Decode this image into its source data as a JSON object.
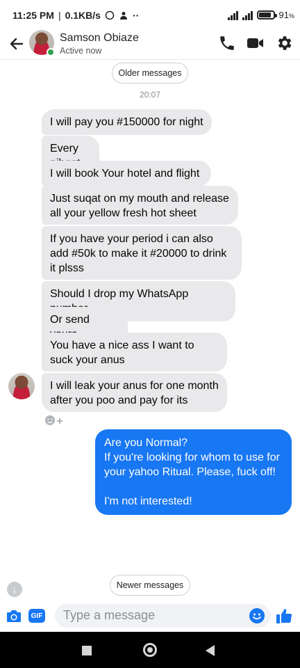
{
  "status_bar": {
    "time": "11:25 PM",
    "speed": "0.1KB/s",
    "battery": "91"
  },
  "header": {
    "name": "Samson Obiaze",
    "status": "Active now"
  },
  "chat": {
    "older_label": "Older messages",
    "timestamp": "20:07",
    "received": [
      "I will pay you #150000 for night",
      "Every nihggt",
      "I will book Your hotel and flight",
      "Just suqat on my mouth and release all your yellow fresh hot sheet",
      "If you have your period i can also add #50k to make it #20000 to drink it plsss",
      "Should I drop my WhatsApp number",
      "Or send yours",
      "You have a nice ass I want to suck your anus",
      "I will leak your anus for one month after you poo and pay for its"
    ],
    "sent": {
      "line1": "Are you Normal?",
      "line2": "If you're looking for whom to use for your yahoo Ritual. Please, fuck off!",
      "line3": "I'm not interested!"
    },
    "newer_label": "Newer messages"
  },
  "composer": {
    "gif_label": "GIF",
    "placeholder": "Type a message"
  },
  "colors": {
    "accent": "#1877f2",
    "received_bubble": "#e9e9eb",
    "online": "#31a24c"
  }
}
